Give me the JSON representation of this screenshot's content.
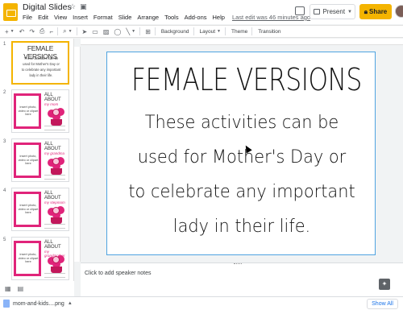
{
  "header": {
    "title": "Digital Slides",
    "menu": [
      "File",
      "Edit",
      "View",
      "Insert",
      "Format",
      "Slide",
      "Arrange",
      "Tools",
      "Add-ons",
      "Help"
    ],
    "last_edit": "Last edit was 46 minutes ago",
    "present_label": "Present",
    "share_label": "Share",
    "brand_color": "#f4b400"
  },
  "toolbar": {
    "background_label": "Background",
    "layout_label": "Layout",
    "theme_label": "Theme",
    "transition_label": "Transition"
  },
  "filmstrip": {
    "slides": [
      {
        "number": "1",
        "title": "FEMALE VERSIONS",
        "lines": [
          "These activities can be",
          "used for Mother's Day or",
          "to celebrate any important",
          "lady in their life."
        ]
      },
      {
        "number": "2",
        "placeholder": "insert photo, video or clipart here",
        "title": "ALL ABOUT",
        "subtitle": "my mom"
      },
      {
        "number": "3",
        "placeholder": "insert photo, video or clipart here",
        "title": "ALL ABOUT",
        "subtitle": "my grandma"
      },
      {
        "number": "4",
        "placeholder": "insert photo, video or clipart here",
        "title": "ALL ABOUT",
        "subtitle": "my stepmom"
      },
      {
        "number": "5",
        "placeholder": "insert photo, video or clipart here",
        "title": "ALL ABOUT",
        "subtitle": "my grandmother"
      }
    ]
  },
  "slide": {
    "title": "FEMALE VERSIONS",
    "lines": [
      "These activities can be",
      "used for Mother's Day or",
      "to celebrate any important",
      "lady in their life."
    ]
  },
  "notes": {
    "placeholder": "Click to add speaker notes"
  },
  "download_bar": {
    "file_name": "mom-and-kids....png",
    "show_all_label": "Show All"
  }
}
